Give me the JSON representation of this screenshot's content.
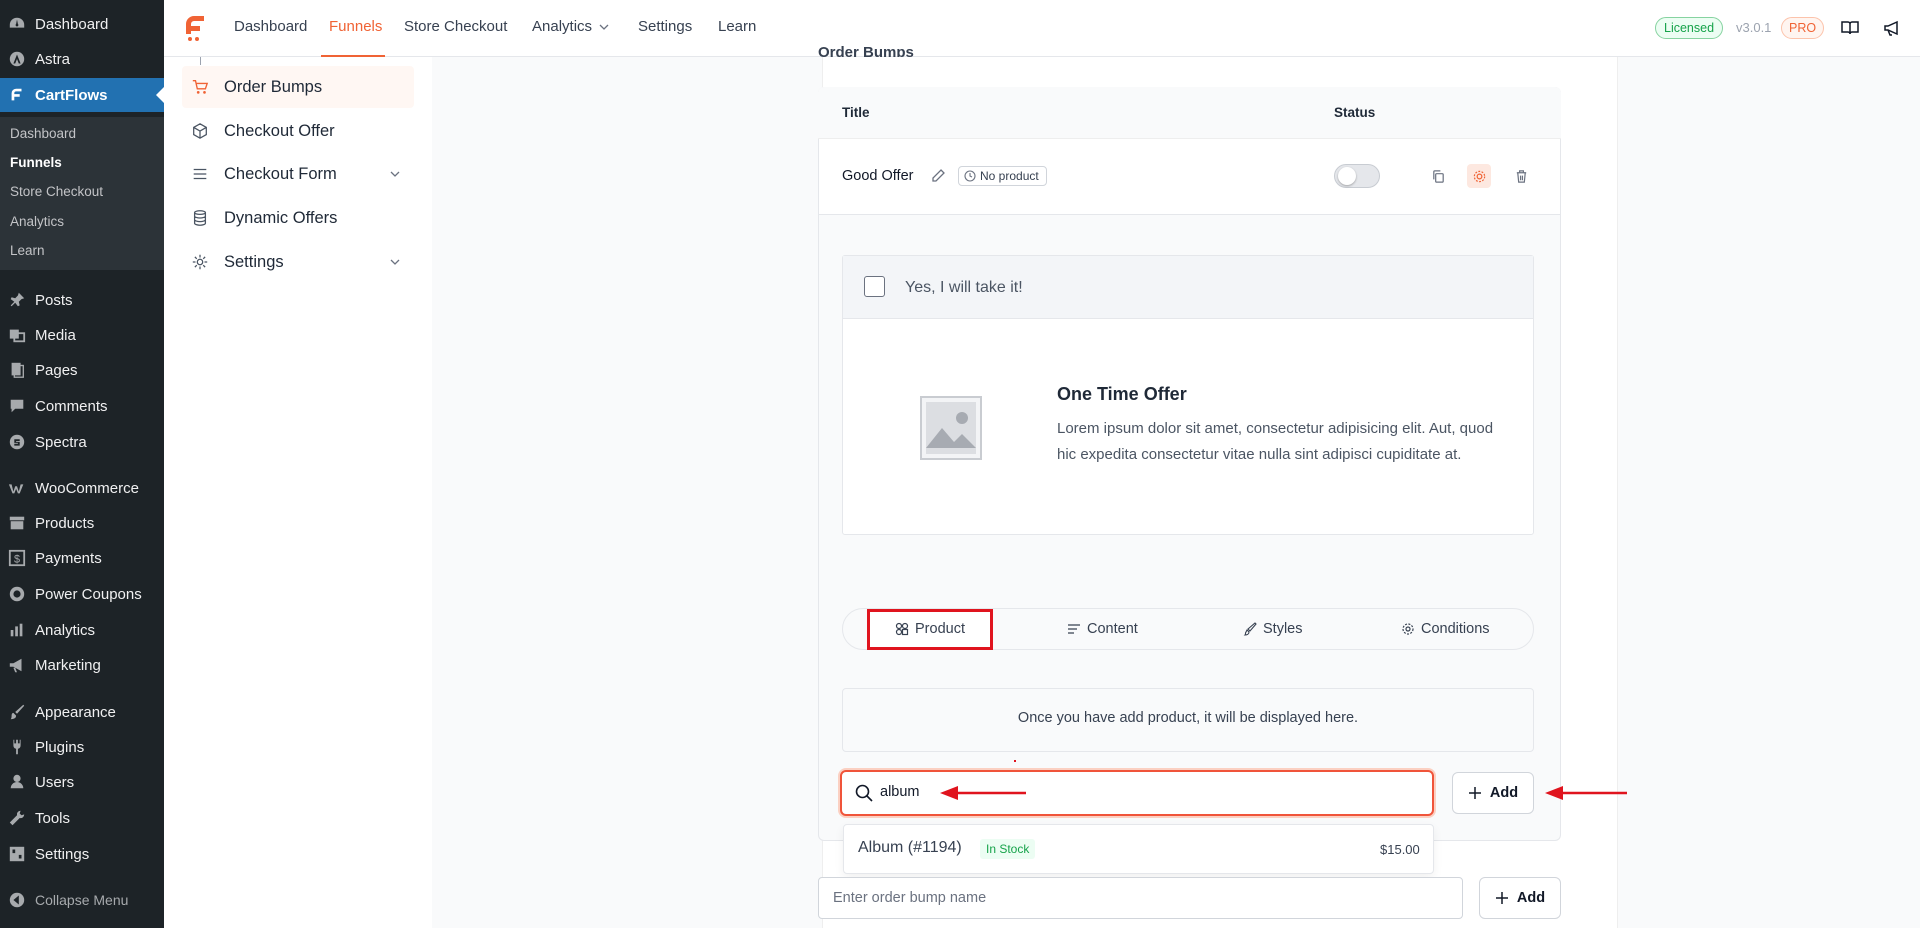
{
  "wp_menu": {
    "items": [
      {
        "label": "Dashboard",
        "icon": "dashboard-icon"
      },
      {
        "label": "Astra",
        "icon": "astra-icon"
      },
      {
        "label": "CartFlows",
        "icon": "cartflows-icon"
      },
      {
        "label": "Posts",
        "icon": "pin-icon"
      },
      {
        "label": "Media",
        "icon": "media-icon"
      },
      {
        "label": "Pages",
        "icon": "pages-icon"
      },
      {
        "label": "Comments",
        "icon": "comment-icon"
      },
      {
        "label": "Spectra",
        "icon": "spectra-icon"
      },
      {
        "label": "WooCommerce",
        "icon": "woo-icon"
      },
      {
        "label": "Products",
        "icon": "archive-icon"
      },
      {
        "label": "Payments",
        "icon": "dollar-icon"
      },
      {
        "label": "Power Coupons",
        "icon": "coupon-icon"
      },
      {
        "label": "Analytics",
        "icon": "bar-chart-icon"
      },
      {
        "label": "Marketing",
        "icon": "megaphone-icon"
      },
      {
        "label": "Appearance",
        "icon": "brush-icon"
      },
      {
        "label": "Plugins",
        "icon": "plug-icon"
      },
      {
        "label": "Users",
        "icon": "user-icon"
      },
      {
        "label": "Tools",
        "icon": "wrench-icon"
      },
      {
        "label": "Settings",
        "icon": "settings-icon"
      }
    ],
    "submenu": [
      "Dashboard",
      "Funnels",
      "Store Checkout",
      "Analytics",
      "Learn"
    ],
    "collapse_label": "Collapse Menu"
  },
  "topbar": {
    "nav": [
      "Dashboard",
      "Funnels",
      "Store Checkout",
      "Analytics",
      "Settings",
      "Learn"
    ],
    "licensed": "Licensed",
    "version": "v3.0.1",
    "pro": "PRO"
  },
  "inner_nav": {
    "items": [
      "Order Bumps",
      "Checkout Offer",
      "Checkout Form",
      "Dynamic Offers",
      "Settings"
    ]
  },
  "section": {
    "partial_title": "Order Bumps",
    "col_title": "Title",
    "col_status": "Status"
  },
  "bump": {
    "title": "Good Offer",
    "product_badge": "No product"
  },
  "preview": {
    "checkbox_label": "Yes, I will take it!",
    "heading": "One Time Offer",
    "description": "Lorem ipsum dolor sit amet, consectetur adipisicing elit. Aut, quod hic expedita consectetur vitae nulla sint adipisci cupiditate at."
  },
  "tabs": [
    "Product",
    "Content",
    "Styles",
    "Conditions"
  ],
  "product": {
    "empty_message": "Once you have add product, it will be displayed here.",
    "search_value": "album",
    "add_label": "Add",
    "result": {
      "name": "Album (#1194)",
      "stock": "In Stock",
      "price": "$15.00"
    }
  },
  "new_bump": {
    "placeholder": "Enter order bump name",
    "add_label": "Add"
  },
  "colors": {
    "accent": "#f06335",
    "wp_active": "#2271b1",
    "highlight": "#e0141e"
  }
}
